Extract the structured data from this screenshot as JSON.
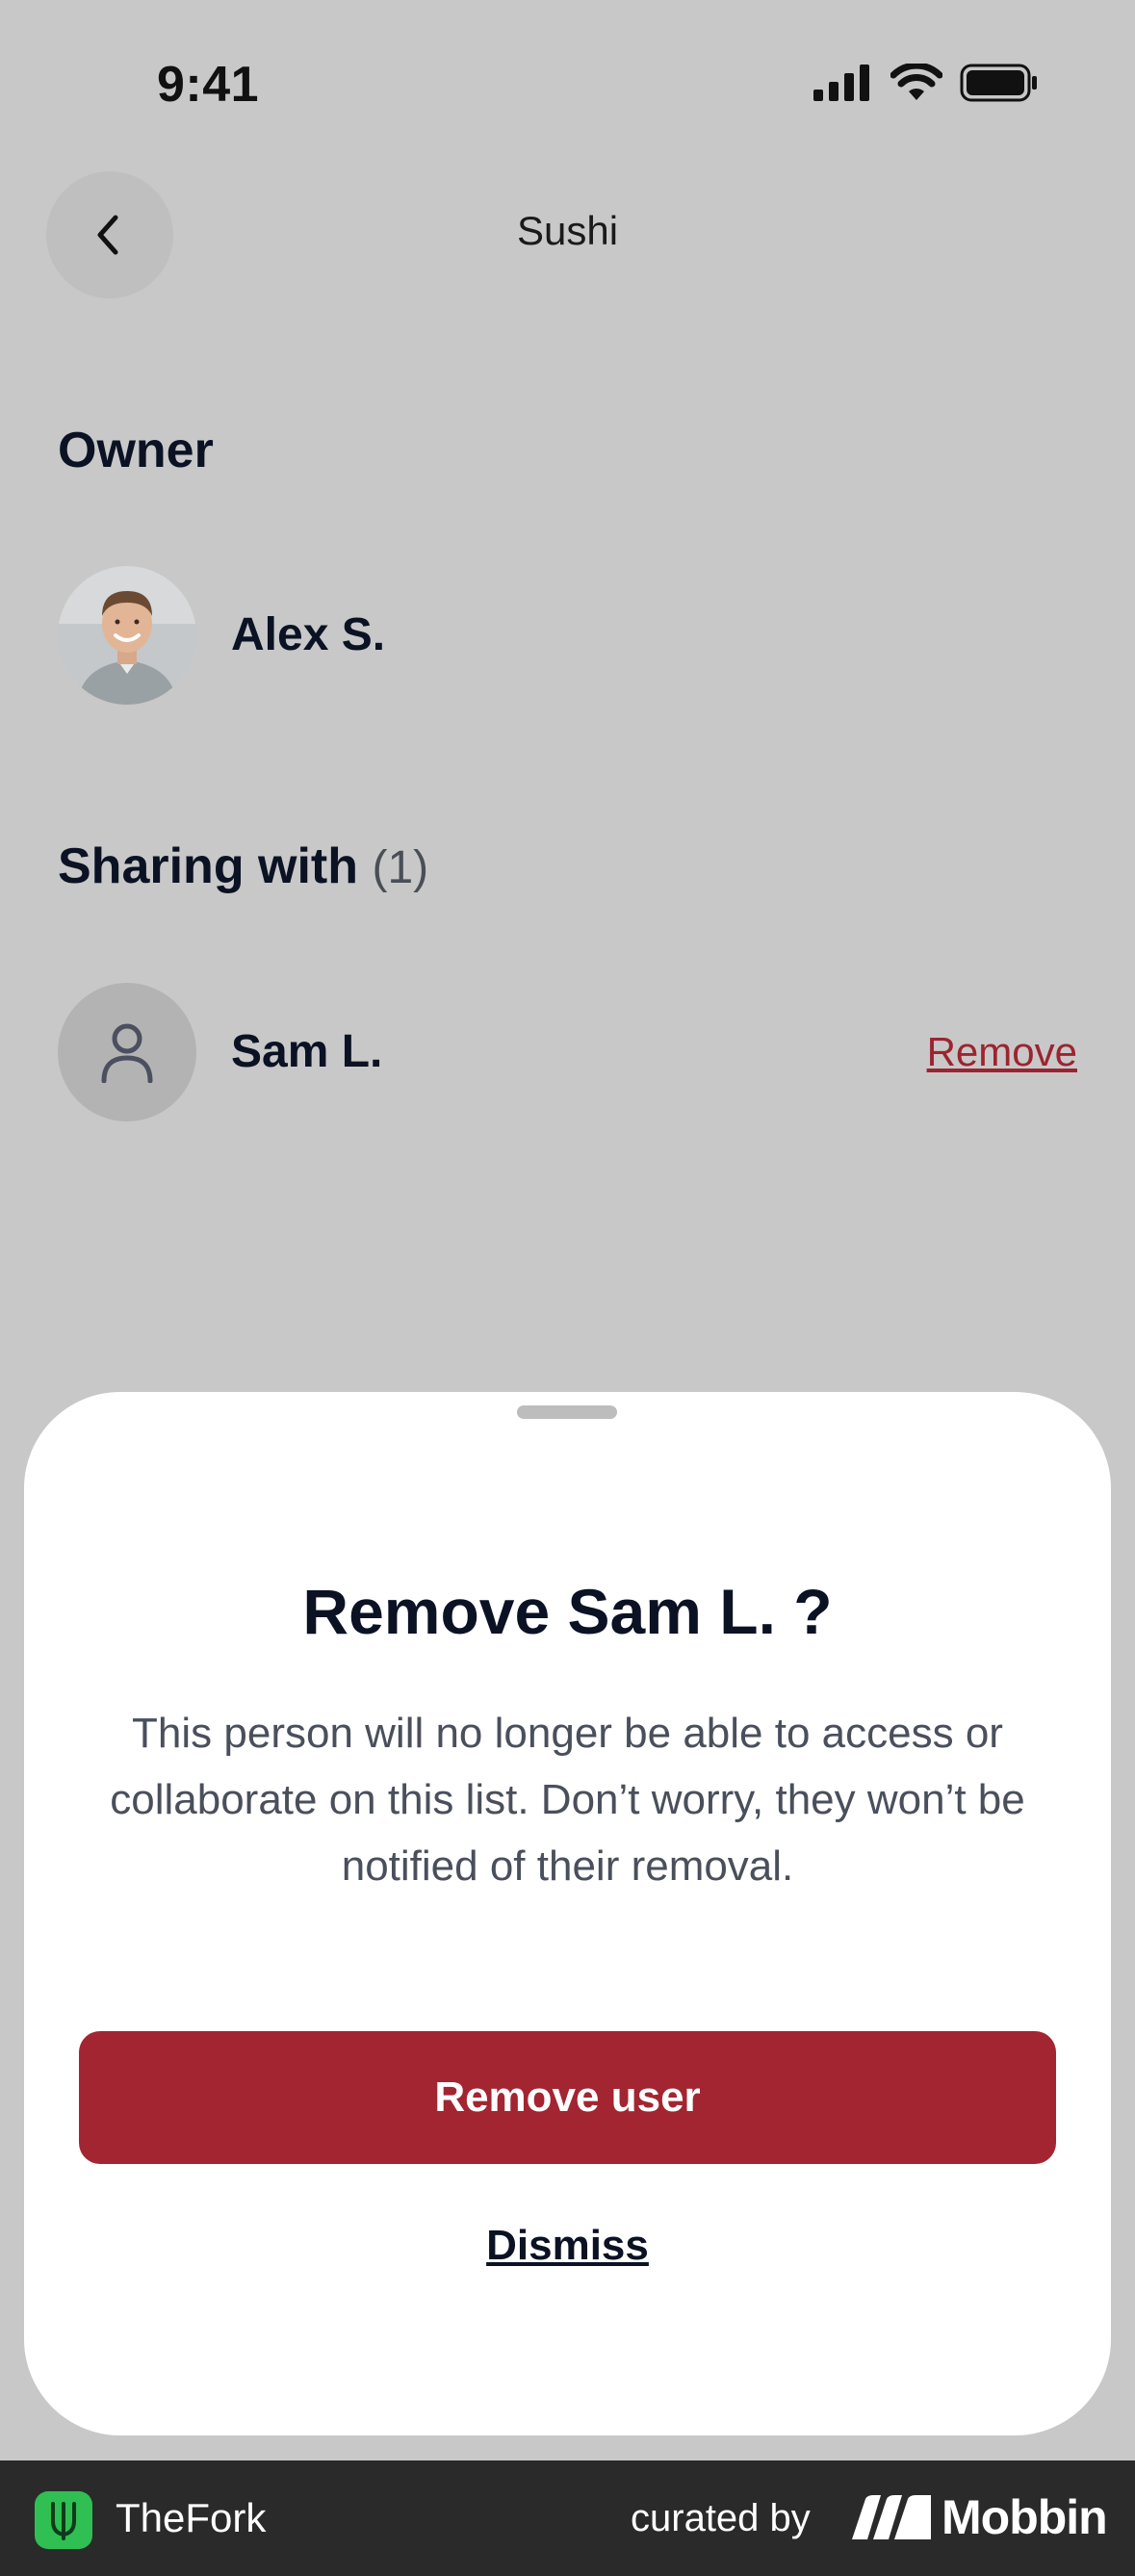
{
  "status_bar": {
    "time": "9:41"
  },
  "nav": {
    "title": "Sushi",
    "back_icon": "chevron-left-icon"
  },
  "owner_section": {
    "title": "Owner",
    "owner": {
      "name": "Alex S.",
      "avatar": "profile-photo"
    }
  },
  "sharing_section": {
    "title": "Sharing with",
    "count": "(1)",
    "users": [
      {
        "name": "Sam L.",
        "avatar_icon": "person-icon",
        "action": "Remove"
      }
    ]
  },
  "sheet": {
    "title": "Remove Sam L. ?",
    "body": "This person will no longer be able to access or collaborate on this list. Don’t worry, they won’t be notified of their removal.",
    "primary_button": "Remove user",
    "dismiss": "Dismiss"
  },
  "footer": {
    "app_name": "TheFork",
    "curated_label": "curated by",
    "brand": "Mobbin"
  },
  "colors": {
    "accent": "#a32531",
    "backdrop": "#c8c8c8",
    "footer_bg": "#2a2a2a",
    "app_logo_green": "#2fbf52"
  }
}
